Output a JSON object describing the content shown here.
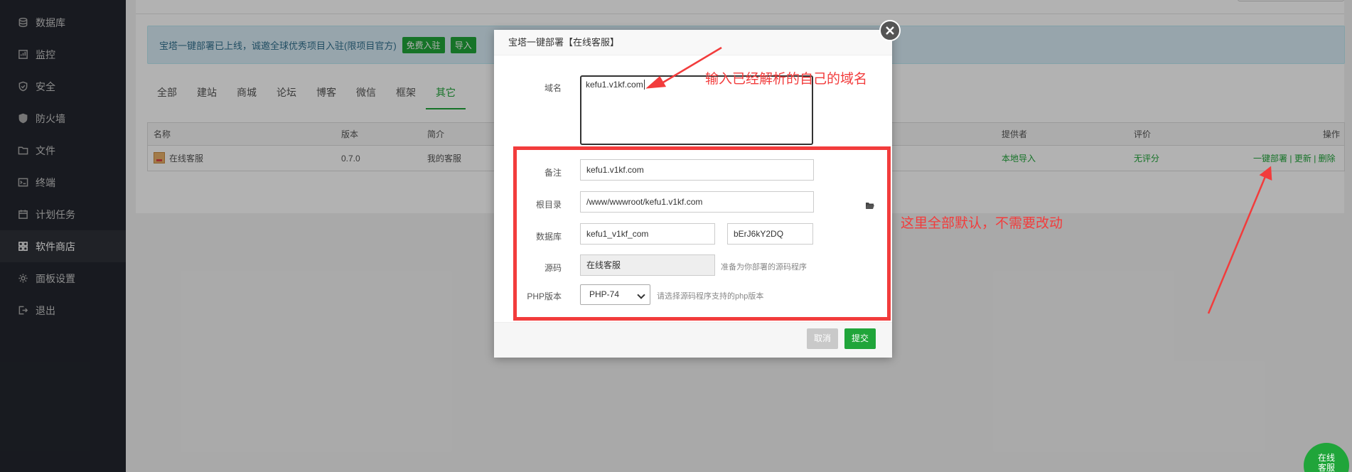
{
  "sidebar": {
    "items": [
      {
        "label": "数据库",
        "icon": "database-icon"
      },
      {
        "label": "监控",
        "icon": "monitor-icon"
      },
      {
        "label": "安全",
        "icon": "shield-icon"
      },
      {
        "label": "防火墙",
        "icon": "firewall-icon"
      },
      {
        "label": "文件",
        "icon": "folder-icon"
      },
      {
        "label": "终端",
        "icon": "terminal-icon"
      },
      {
        "label": "计划任务",
        "icon": "calendar-icon"
      },
      {
        "label": "软件商店",
        "icon": "grid-icon"
      },
      {
        "label": "面板设置",
        "icon": "gear-icon"
      },
      {
        "label": "退出",
        "icon": "logout-icon"
      }
    ]
  },
  "notice": {
    "text": "宝塔一键部署已上线，诚邀全球优秀项目入驻(限项目官方)",
    "btn_join": "免费入驻",
    "btn_import": "导入"
  },
  "tabs": [
    "全部",
    "建站",
    "商城",
    "论坛",
    "博客",
    "微信",
    "框架",
    "其它"
  ],
  "table": {
    "headers": {
      "name": "名称",
      "version": "版本",
      "desc": "简介",
      "provider": "提供者",
      "rating": "评价",
      "ops": "操作"
    },
    "row": {
      "name": "在线客服",
      "version": "0.7.0",
      "desc": "我的客服",
      "provider": "本地导入",
      "rating": "无评分",
      "op_deploy": "一键部署",
      "op_update": "更新",
      "op_delete": "删除",
      "sep": "|"
    }
  },
  "dialog": {
    "title": "宝塔一键部署【在线客服】",
    "domain_label": "域名",
    "domain_value": "kefu1.v1kf.com",
    "remark_label": "备注",
    "remark_value": "kefu1.v1kf.com",
    "root_label": "根目录",
    "root_value": "/www/wwwroot/kefu1.v1kf.com",
    "db_label": "数据库",
    "db_name": "kefu1_v1kf_com",
    "db_pass": "bErJ6kY2DQ",
    "source_label": "源码",
    "source_value": "在线客服",
    "source_hint": "准备为你部署的源码程序",
    "php_label": "PHP版本",
    "php_value": "PHP-74",
    "php_hint": "请选择源码程序支持的php版本",
    "cancel": "取消",
    "submit": "提交"
  },
  "annotations": {
    "top": "输入已经解析的自己的域名",
    "right": "这里全部默认，不需要改动",
    "color": "#f23c3c"
  },
  "kefu": {
    "line1": "在线",
    "line2": "客服"
  },
  "colors": {
    "accent": "#20a53a",
    "sidebar": "#23262e",
    "notice_bg": "#d9edf7"
  }
}
